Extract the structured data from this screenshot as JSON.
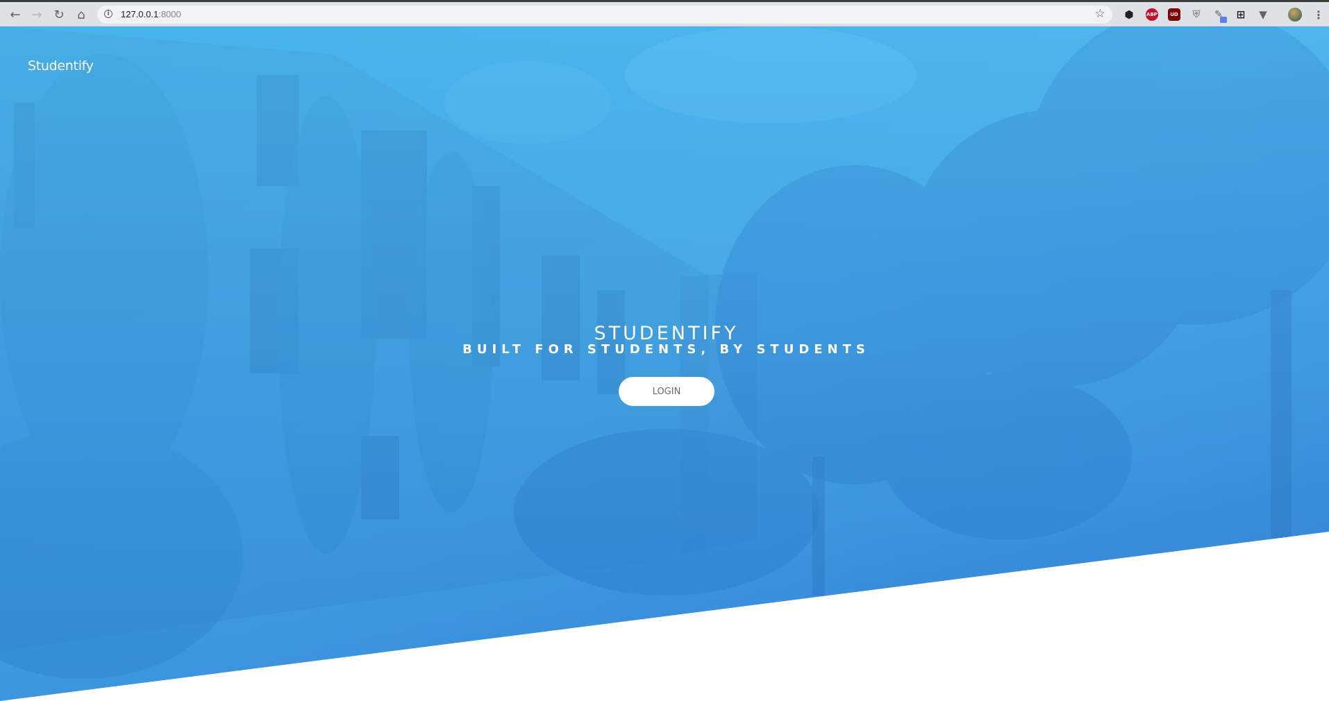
{
  "browser": {
    "url_host": "127.0.0.1",
    "url_port": ":8000",
    "nav": {
      "back_icon": "arrow-left-icon",
      "forward_icon": "arrow-right-icon",
      "reload_icon": "reload-icon",
      "home_icon": "home-icon"
    },
    "extensions": [
      {
        "name": "cube-extension-icon"
      },
      {
        "name": "adblock-plus-icon",
        "label": "ABP"
      },
      {
        "name": "ublock-origin-icon",
        "label": "UD"
      },
      {
        "name": "shield-extension-icon"
      },
      {
        "name": "pen-extension-icon"
      },
      {
        "name": "crop-extension-icon"
      },
      {
        "name": "vee-extension-icon"
      },
      {
        "name": "profile-avatar-icon"
      },
      {
        "name": "browser-menu-icon"
      }
    ]
  },
  "site": {
    "brand": "Studentify",
    "hero": {
      "title": "STUDENTIFY",
      "subtitle": "BUILT FOR STUDENTS, BY STUDENTS",
      "login_label": "LOGIN"
    }
  },
  "colors": {
    "overlay_top": "#4fb8ec",
    "overlay_bottom": "#2f7fd6",
    "foliage": "#2e8fc8",
    "building": "#3a95d2"
  }
}
